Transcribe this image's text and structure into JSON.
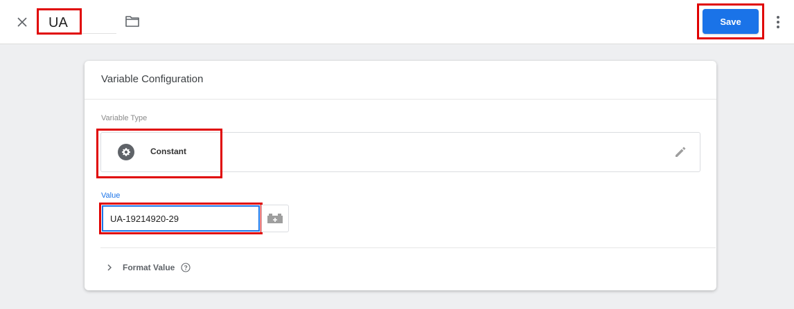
{
  "header": {
    "name_value": "UA",
    "save_label": "Save"
  },
  "card": {
    "title": "Variable Configuration",
    "variable_type_label": "Variable Type",
    "variable_type_name": "Constant",
    "value_label": "Value",
    "value_input": "UA-19214920-29",
    "format_value_label": "Format Value"
  },
  "icons": {
    "close": "close-icon",
    "folder": "folder-icon",
    "more": "more-vert-icon",
    "type": "gear-icon",
    "edit": "pencil-icon",
    "variable_picker": "variable-brick-icon",
    "expand": "chevron-right-icon",
    "help": "help-icon"
  },
  "colors": {
    "accent": "#1a73e8",
    "highlight": "#e00000"
  }
}
